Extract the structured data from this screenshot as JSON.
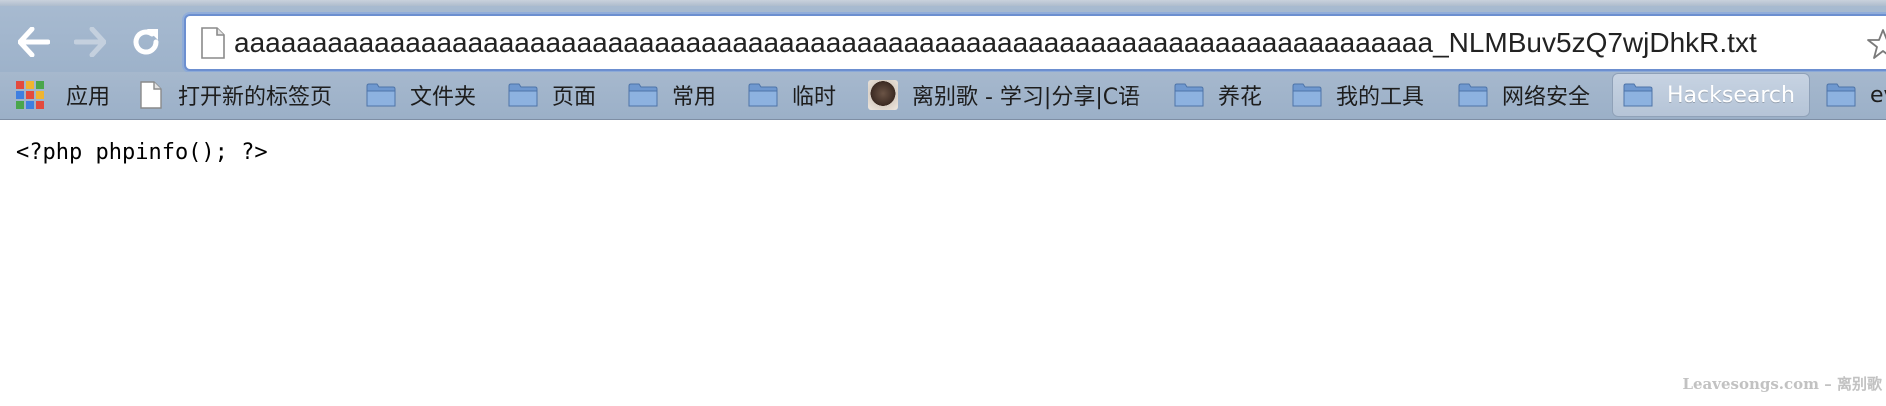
{
  "browser": {
    "omnibox": {
      "url": "aaaaaaaaaaaaaaaaaaaaaaaaaaaaaaaaaaaaaaaaaaaaaaaaaaaaaaaaaaaaaaaaaaaaaaaaaaaaa_NLMBuv5zQ7wjDhkR.txt"
    },
    "icons": {
      "back": "back-arrow-icon",
      "forward": "forward-arrow-icon",
      "reload": "reload-icon",
      "page": "page-document-icon",
      "star": "star-bookmark-icon"
    }
  },
  "bookmarks": [
    {
      "label": "应用",
      "icon": "apps-grid-icon"
    },
    {
      "label": "打开新的标签页",
      "icon": "page-icon"
    },
    {
      "label": "文件夹",
      "icon": "folder-icon"
    },
    {
      "label": "页面",
      "icon": "folder-icon"
    },
    {
      "label": "常用",
      "icon": "folder-icon"
    },
    {
      "label": "临时",
      "icon": "folder-icon"
    },
    {
      "label": "离别歌 - 学习|分享|C语",
      "icon": "avatar-favicon"
    },
    {
      "label": "养花",
      "icon": "folder-icon"
    },
    {
      "label": "我的工具",
      "icon": "folder-icon"
    },
    {
      "label": "网络安全",
      "icon": "folder-icon"
    },
    {
      "label": "Hacksearch",
      "icon": "folder-icon"
    },
    {
      "label": "ev",
      "icon": "folder-icon"
    }
  ],
  "page": {
    "content": "<?php phpinfo(); ?>",
    "watermark": "Leavesongs.com – 离别歌"
  },
  "colors": {
    "toolbar": "#a7bad0",
    "omnibox_focus": "#6c8fd0",
    "folder": "#7fa6d6"
  }
}
